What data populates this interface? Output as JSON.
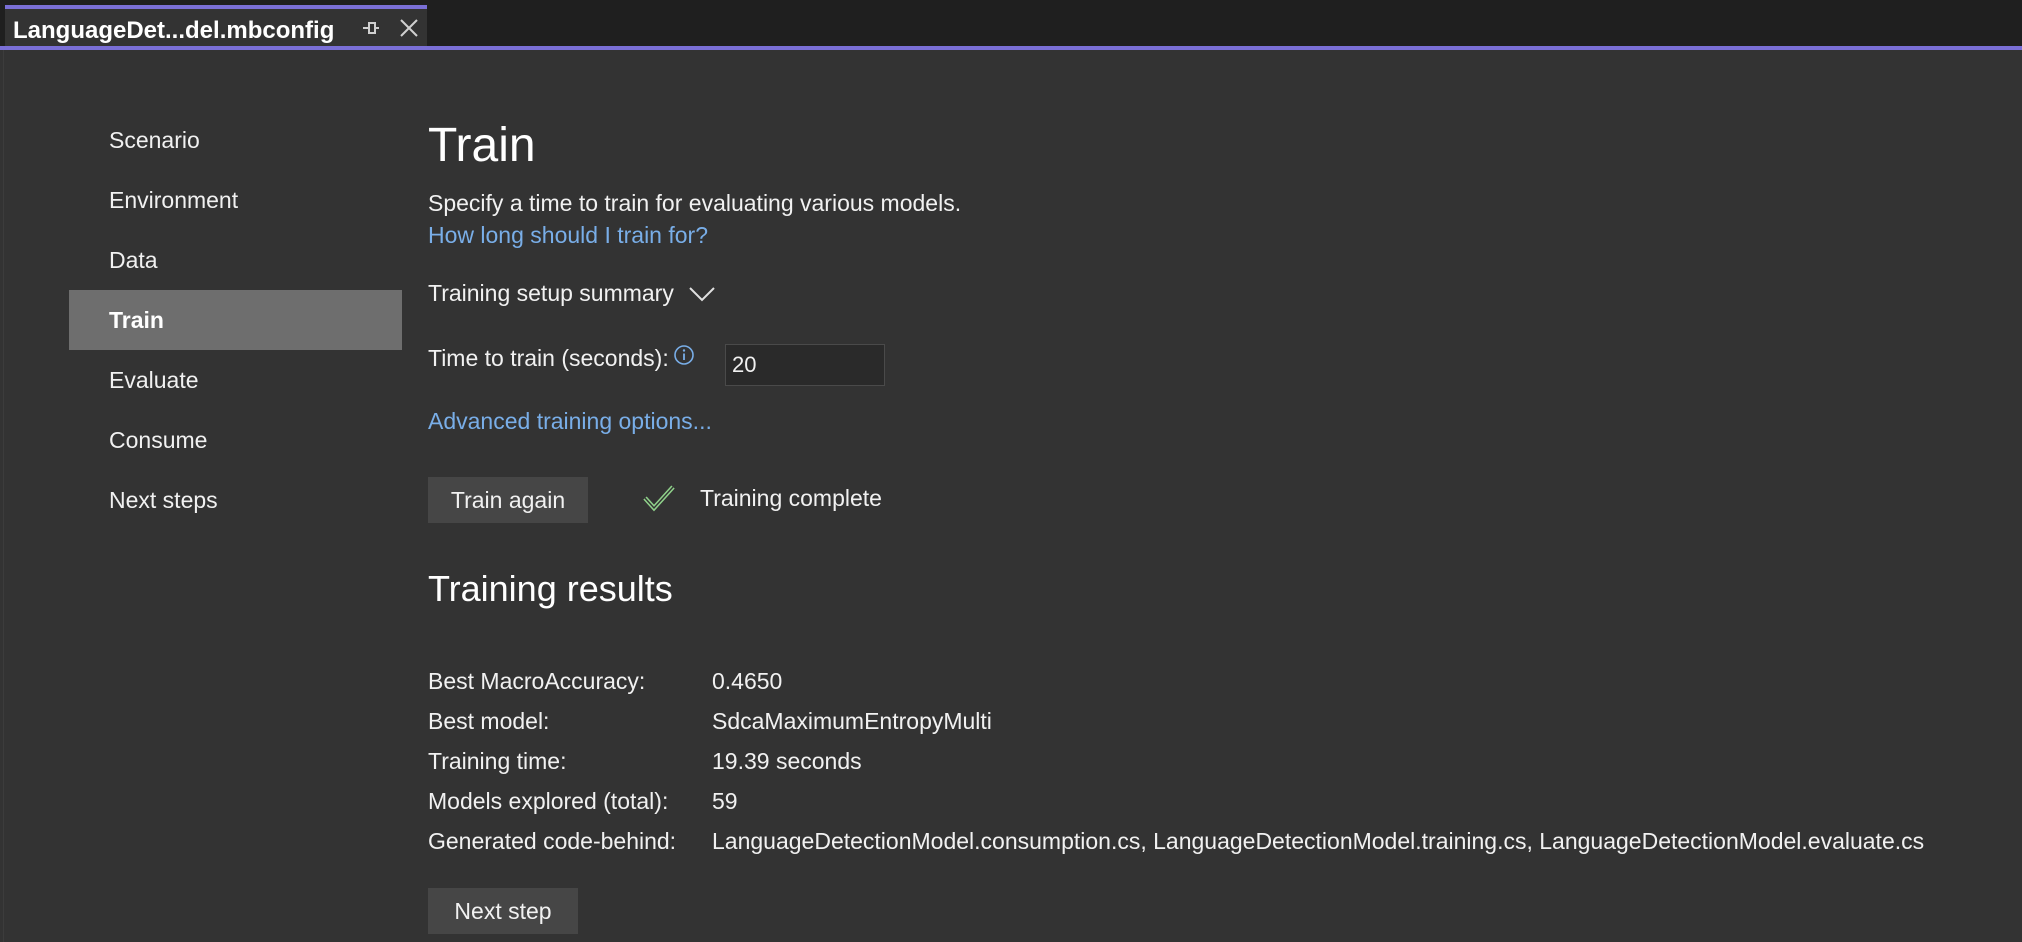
{
  "window": {
    "tab_title": "LanguageDet...del.mbconfig",
    "accent_color": "#7a6fd6"
  },
  "sidebar": {
    "items": [
      {
        "label": "Scenario"
      },
      {
        "label": "Environment"
      },
      {
        "label": "Data"
      },
      {
        "label": "Train",
        "active": true
      },
      {
        "label": "Evaluate"
      },
      {
        "label": "Consume"
      },
      {
        "label": "Next steps"
      }
    ]
  },
  "main": {
    "title": "Train",
    "description": "Specify a time to train for evaluating various models.",
    "help_link": "How long should I train for?",
    "summary_label": "Training setup summary",
    "time_label": "Time to train (seconds):",
    "time_value": "20",
    "advanced_link": "Advanced training options...",
    "train_button": "Train again",
    "status_text": "Training complete",
    "results_title": "Training results",
    "results": [
      {
        "key": "Best MacroAccuracy:",
        "value": "0.4650"
      },
      {
        "key": "Best model:",
        "value": "SdcaMaximumEntropyMulti"
      },
      {
        "key": "Training time:",
        "value": "19.39 seconds"
      },
      {
        "key": "Models explored (total):",
        "value": "59"
      },
      {
        "key": "Generated code-behind:",
        "value": "LanguageDetectionModel.consumption.cs, LanguageDetectionModel.training.cs, LanguageDetectionModel.evaluate.cs"
      }
    ],
    "next_button": "Next step"
  },
  "icons": {
    "pin": "pin-icon",
    "close": "close-icon",
    "chevron": "chevron-down-icon",
    "info": "info-icon",
    "check": "checkmark-icon"
  },
  "colors": {
    "link": "#79aee8",
    "success": "#8fd18a",
    "background": "#333333"
  }
}
